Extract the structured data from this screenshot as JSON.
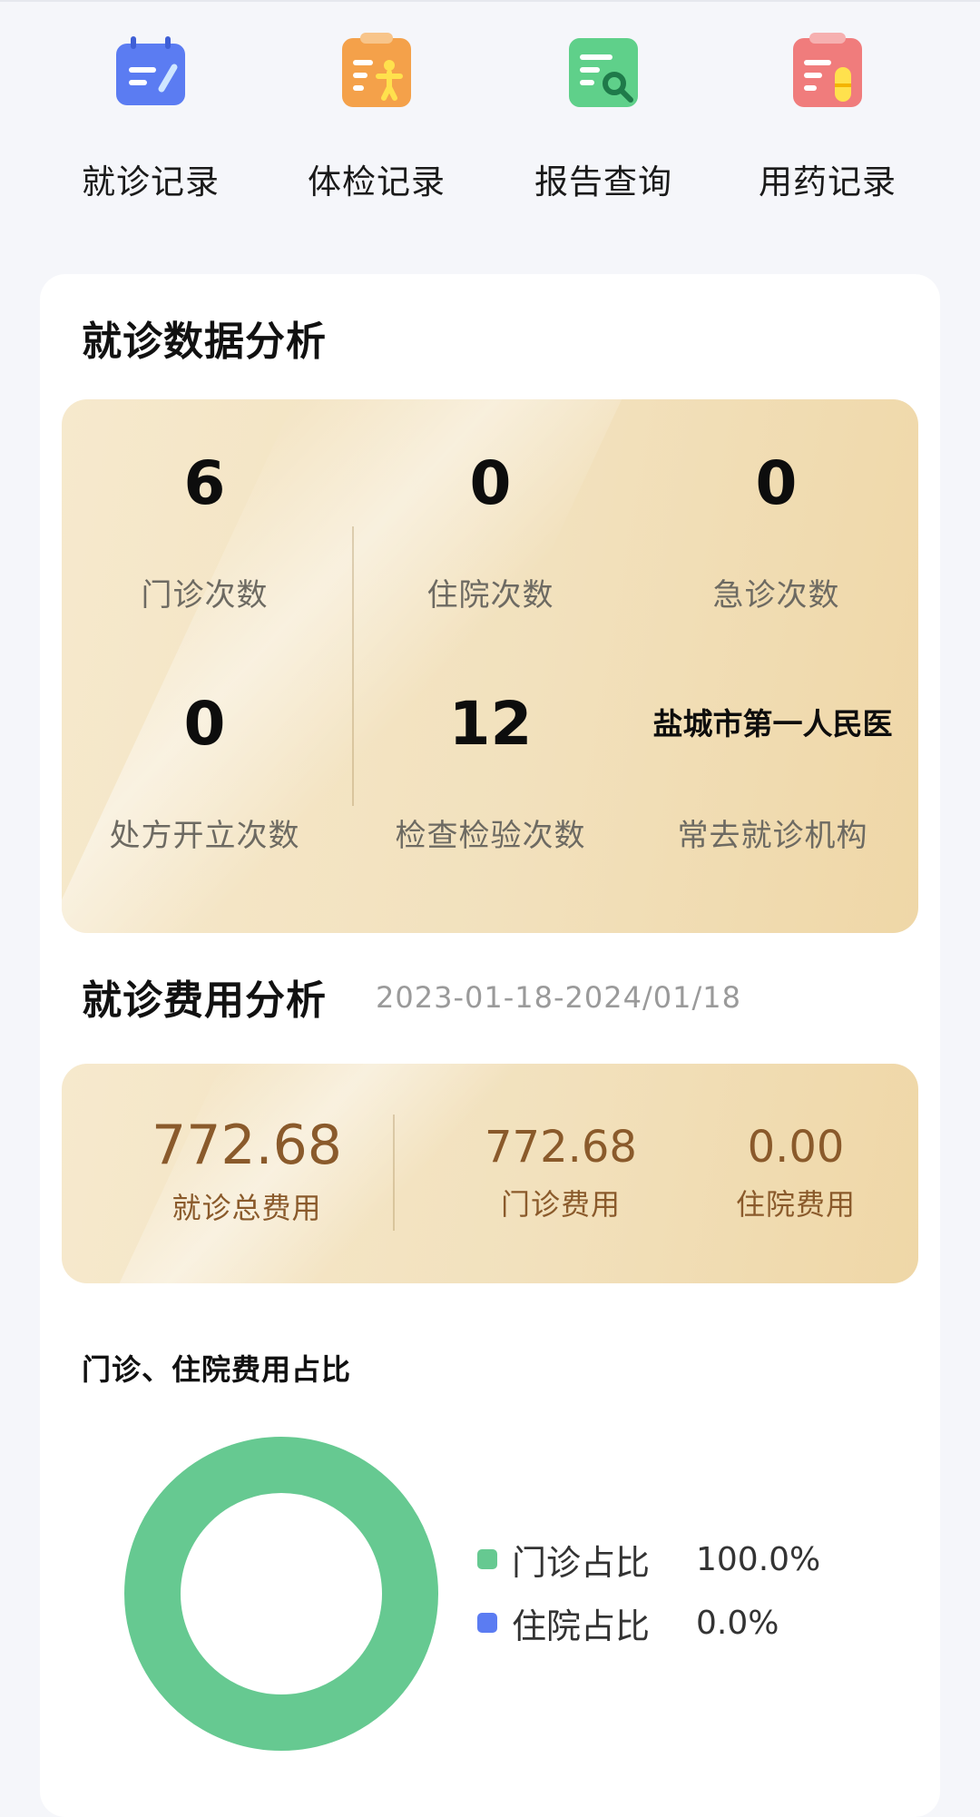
{
  "quick_actions": [
    {
      "label": "就诊记录",
      "icon": "visit-record-icon",
      "color": "#5b7cf2"
    },
    {
      "label": "体检记录",
      "icon": "checkup-record-icon",
      "color": "#f4a14a"
    },
    {
      "label": "报告查询",
      "icon": "report-search-icon",
      "color": "#5fd08a"
    },
    {
      "label": "用药记录",
      "icon": "medication-record-icon",
      "color": "#f07c7c"
    }
  ],
  "visit_analysis": {
    "title": "就诊数据分析",
    "stats": [
      {
        "value": "6",
        "label": "门诊次数"
      },
      {
        "value": "0",
        "label": "住院次数"
      },
      {
        "value": "0",
        "label": "急诊次数"
      },
      {
        "value": "0",
        "label": "处方开立次数"
      },
      {
        "value": "12",
        "label": "检查检验次数"
      },
      {
        "value": "盐城市第一人民医",
        "label": "常去就诊机构"
      }
    ]
  },
  "fee_analysis": {
    "title": "就诊费用分析",
    "date_range": "2023-01-18-2024/01/18",
    "total": {
      "value": "772.68",
      "label": "就诊总费用"
    },
    "outpatient": {
      "value": "772.68",
      "label": "门诊费用"
    },
    "inpatient": {
      "value": "0.00",
      "label": "住院费用"
    }
  },
  "ratio": {
    "title": "门诊、住院费用占比",
    "legend": [
      {
        "label": "门诊占比",
        "value": "100.0%",
        "color": "#66c991",
        "fraction": 1.0
      },
      {
        "label": "住院占比",
        "value": "0.0%",
        "color": "#5b7cf2",
        "fraction": 0.0
      }
    ]
  }
}
